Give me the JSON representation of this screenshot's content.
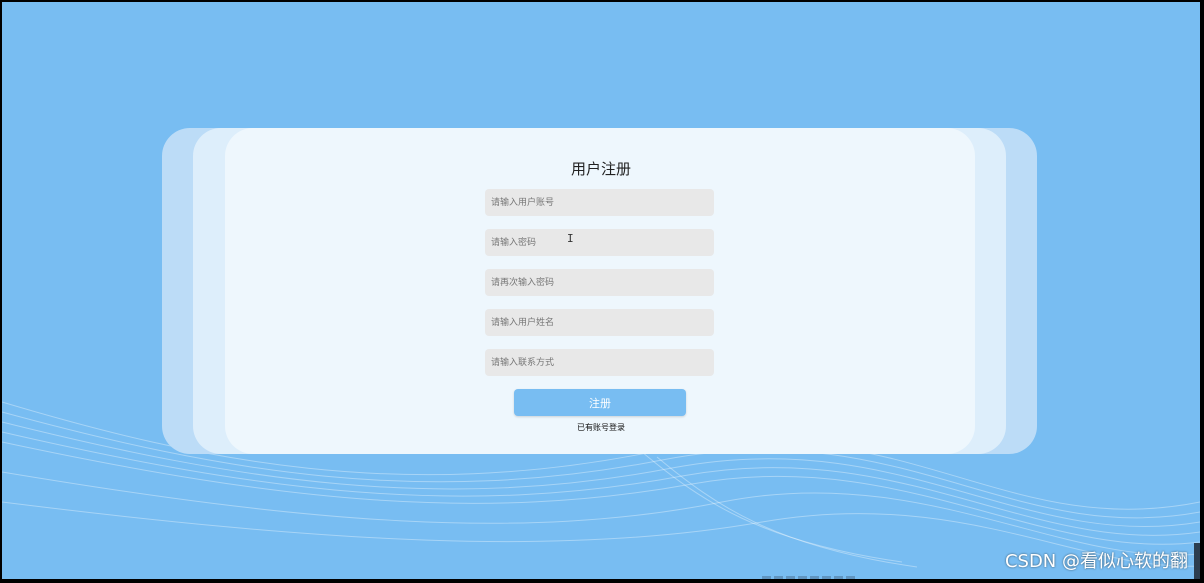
{
  "form": {
    "title": "用户注册",
    "fields": [
      {
        "name": "username",
        "placeholder": "请输入用户账号",
        "value": ""
      },
      {
        "name": "password",
        "placeholder": "请输入密码",
        "value": ""
      },
      {
        "name": "confirm_password",
        "placeholder": "请再次输入密码",
        "value": ""
      },
      {
        "name": "real_name",
        "placeholder": "请输入用户姓名",
        "value": ""
      },
      {
        "name": "contact",
        "placeholder": "请输入联系方式",
        "value": ""
      }
    ],
    "submit_label": "注册",
    "login_link": "已有账号登录"
  },
  "watermark": "CSDN @看似心软的翻",
  "cursor_icon": "text-cursor-icon",
  "colors": {
    "background": "#78bdf2",
    "card": "#eef7fd",
    "button": "#78bdf2",
    "field": "#e8e8e8"
  }
}
